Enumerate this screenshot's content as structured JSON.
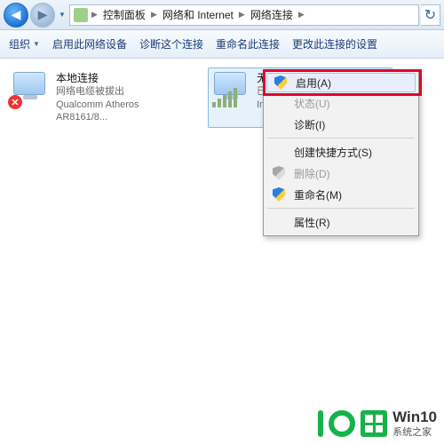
{
  "nav": {
    "breadcrumb": [
      "控制面板",
      "网络和 Internet",
      "网络连接"
    ]
  },
  "toolbar": {
    "organize": "组织",
    "enable_device": "启用此网络设备",
    "diagnose": "诊断这个连接",
    "rename": "重命名此连接",
    "change_settings": "更改此连接的设置"
  },
  "connections": [
    {
      "title": "本地连接",
      "status": "网络电缆被拔出",
      "adapter": "Qualcomm Atheros AR8161/8..."
    },
    {
      "title": "无线网络连接",
      "status": "已禁",
      "adapter": "Inte"
    }
  ],
  "context_menu": {
    "enable": "启用(A)",
    "status": "状态(U)",
    "diagnose": "诊断(I)",
    "shortcut": "创建快捷方式(S)",
    "delete": "删除(D)",
    "rename": "重命名(M)",
    "properties": "属性(R)"
  },
  "watermark": {
    "brand": "Win10",
    "site": "系统之家"
  }
}
